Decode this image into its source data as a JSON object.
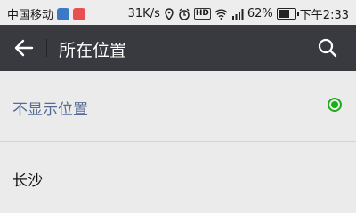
{
  "status_bar": {
    "carrier": "中国移动",
    "speed": "31K/s",
    "hd": "HD",
    "signal_type": "4G",
    "battery": "62%",
    "battery_level": 0.62,
    "time": "下午2:33"
  },
  "app_bar": {
    "title": "所在位置",
    "icons": [
      "back-arrow-icon",
      "search-icon"
    ]
  },
  "list": {
    "items": [
      {
        "label": "不显示位置",
        "selected": true
      },
      {
        "label": "长沙",
        "selected": false
      }
    ]
  },
  "colors": {
    "app_bar_bg": "#393a3f",
    "accent_green": "#1aad19",
    "selected_text": "#566b94",
    "page_bg": "#ebebeb"
  }
}
